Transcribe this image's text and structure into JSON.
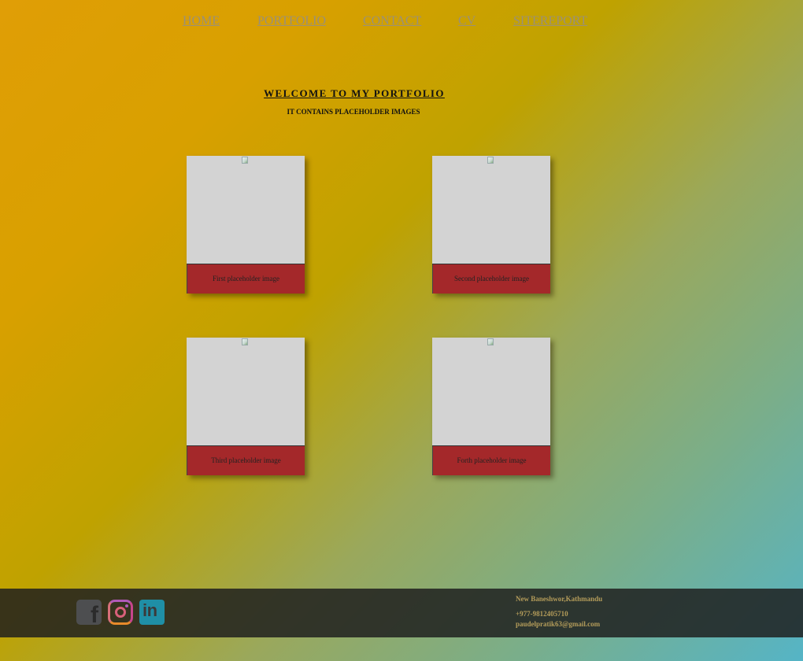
{
  "nav": {
    "items": [
      {
        "label": "HOME"
      },
      {
        "label": "PORTFOLIO"
      },
      {
        "label": "CONTACT"
      },
      {
        "label": "CV"
      },
      {
        "label": "SITEREPORT"
      }
    ]
  },
  "hero": {
    "title": "WELCOME TO MY PORTFOLIO",
    "subtitle": "IT CONTAINS PLACEHOLDER IMAGES"
  },
  "cards": [
    {
      "caption": "First placeholder image"
    },
    {
      "caption": "Second placeholder image"
    },
    {
      "caption": "Third placeholder image"
    },
    {
      "caption": "Forth placeholder image"
    }
  ],
  "footer": {
    "social": {
      "facebook_icon": "facebook-icon",
      "instagram_icon": "instagram-icon",
      "linkedin_icon": "linkedin-icon",
      "facebook_glyph": "f",
      "linkedin_glyph": "in"
    },
    "address": "New Baneshwor,Kathmandu",
    "phone": "+977-9812405710",
    "email": "paudelpratik63@gmail.com"
  },
  "colors": {
    "caption_bg": "#a4282a",
    "image_bg": "#d3d3d3",
    "footer_bg": "#1e1e1e",
    "footer_text": "#b49c5a"
  }
}
